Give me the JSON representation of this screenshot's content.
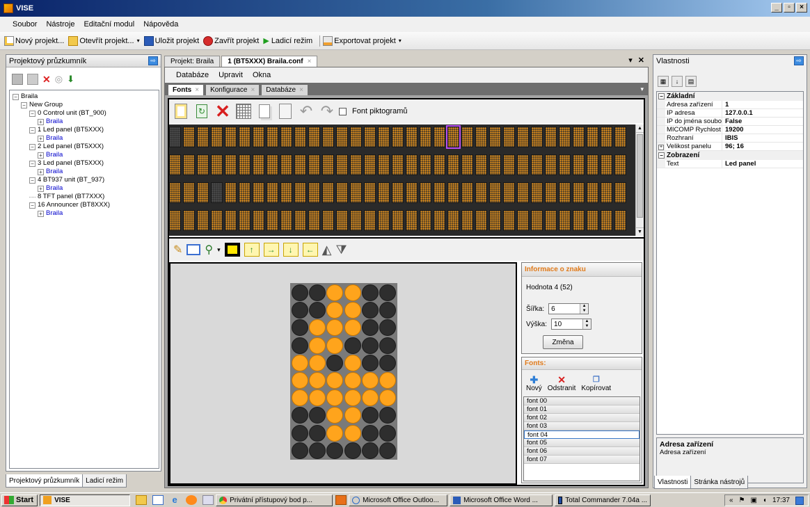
{
  "window": {
    "title": "VISE"
  },
  "menu": [
    "Soubor",
    "Nástroje",
    "Editační modul",
    "Nápověda"
  ],
  "toolbar": {
    "new_project": "Nový projekt...",
    "open_project": "Otevřít projekt...",
    "save_project": "Uložit projekt",
    "close_project": "Zavřít projekt",
    "debug_mode": "Ladicí režim",
    "export_project": "Exportovat projekt"
  },
  "left_panel": {
    "title": "Projektový průzkumník",
    "tree": [
      {
        "label": "Braila",
        "level": 0,
        "expander": "-",
        "link": false
      },
      {
        "label": "New Group",
        "level": 1,
        "expander": "-",
        "link": false
      },
      {
        "label": "0 Control unit (BT_900)",
        "level": 2,
        "expander": "-",
        "link": false
      },
      {
        "label": "Braila",
        "level": 3,
        "expander": "+",
        "link": true
      },
      {
        "label": "1 Led panel (BT5XXX)",
        "level": 2,
        "expander": "-",
        "link": false
      },
      {
        "label": "Braila",
        "level": 3,
        "expander": "+",
        "link": true
      },
      {
        "label": "2 Led panel (BT5XXX)",
        "level": 2,
        "expander": "-",
        "link": false
      },
      {
        "label": "Braila",
        "level": 3,
        "expander": "+",
        "link": true
      },
      {
        "label": "3 Led panel (BT5XXX)",
        "level": 2,
        "expander": "-",
        "link": false
      },
      {
        "label": "Braila",
        "level": 3,
        "expander": "+",
        "link": true
      },
      {
        "label": "4 BT937 unit (BT_937)",
        "level": 2,
        "expander": "-",
        "link": false
      },
      {
        "label": "Braila",
        "level": 3,
        "expander": "+",
        "link": true
      },
      {
        "label": "8 TFT panel (BT7XXX)",
        "level": 2,
        "expander": "",
        "link": false
      },
      {
        "label": "16 Announcer (BT8XXX)",
        "level": 2,
        "expander": "-",
        "link": false
      },
      {
        "label": "Braila",
        "level": 3,
        "expander": "+",
        "link": true
      }
    ],
    "bottom_tabs": [
      "Projektový průzkumník",
      "Ladicí režim"
    ]
  },
  "doc_tabs": [
    {
      "label": "Projekt: Braila",
      "active": false,
      "closable": false
    },
    {
      "label": "1 (BT5XXX) Braila.conf",
      "active": true,
      "closable": true
    }
  ],
  "doc_menu": [
    "Databáze",
    "Upravit",
    "Okna"
  ],
  "sub_tabs": [
    {
      "label": "Fonts",
      "active": true
    },
    {
      "label": "Konfigurace",
      "active": false
    },
    {
      "label": "Databáze",
      "active": false
    }
  ],
  "fonts_toolbar": {
    "pictogram_checkbox": "Font piktogramů",
    "pictogram_checked": false
  },
  "char_info": {
    "title": "Informace o znaku",
    "value_label": "Hodnota 4 (52)",
    "width_label": "Šířka:",
    "width_value": "6",
    "height_label": "Výška:",
    "height_value": "10",
    "change_button": "Změna"
  },
  "led_matrix": {
    "cols": 6,
    "rows": 10,
    "pixels": [
      [
        0,
        0,
        1,
        1,
        0,
        0
      ],
      [
        0,
        0,
        1,
        1,
        0,
        0
      ],
      [
        0,
        1,
        1,
        1,
        0,
        0
      ],
      [
        0,
        1,
        1,
        0,
        0,
        0
      ],
      [
        1,
        1,
        0,
        1,
        0,
        0
      ],
      [
        1,
        1,
        1,
        1,
        1,
        1
      ],
      [
        1,
        1,
        1,
        1,
        1,
        1
      ],
      [
        0,
        0,
        1,
        1,
        0,
        0
      ],
      [
        0,
        0,
        1,
        1,
        0,
        0
      ],
      [
        0,
        0,
        0,
        0,
        0,
        0
      ]
    ],
    "on_color": "#ffa41c",
    "off_color": "#2e2e2e"
  },
  "fonts_box": {
    "title": "Fonts:",
    "new": "Nový",
    "remove": "Odstranit",
    "copy": "Kopírovat",
    "items": [
      "font 00",
      "font 01",
      "font 02",
      "font 03",
      "font 04",
      "font 05",
      "font 06",
      "font 07"
    ],
    "selected": "font 04"
  },
  "right_panel": {
    "title": "Vlastnosti",
    "categories": [
      {
        "name": "Základní",
        "expander": "-",
        "rows": [
          {
            "k": "Adresa zařízení",
            "v": "1"
          },
          {
            "k": "IP adresa",
            "v": "127.0.0.1"
          },
          {
            "k": "IP do jména soubo",
            "v": "False"
          },
          {
            "k": "MICOMP Rychlost",
            "v": "19200"
          },
          {
            "k": "Rozhraní",
            "v": "IBIS"
          },
          {
            "k": "Velikost panelu",
            "v": "96; 16",
            "expander": "+"
          }
        ]
      },
      {
        "name": "Zobrazení",
        "expander": "-",
        "rows": [
          {
            "k": "Text",
            "v": "Led panel"
          }
        ]
      }
    ],
    "desc_title": "Adresa zařízení",
    "desc_text": "Adresa zařízení",
    "bottom_tabs": [
      "Vlastnosti",
      "Stránka nástrojů"
    ]
  },
  "taskbar": {
    "start": "Start",
    "tasks": [
      {
        "label": "VISE",
        "active": true
      },
      {
        "label": "Privátní přístupový bod p...",
        "active": false
      },
      {
        "label": "Microsoft Office Outloo...",
        "active": false
      },
      {
        "label": "Microsoft Office Word ...",
        "active": false
      },
      {
        "label": "Total Commander 7.04a ...",
        "active": false
      }
    ],
    "clock": "17:37"
  },
  "colors": {
    "led_on": "#ffa41c",
    "accent_orange": "#e07a1a",
    "title_blue": "#0a246a"
  }
}
